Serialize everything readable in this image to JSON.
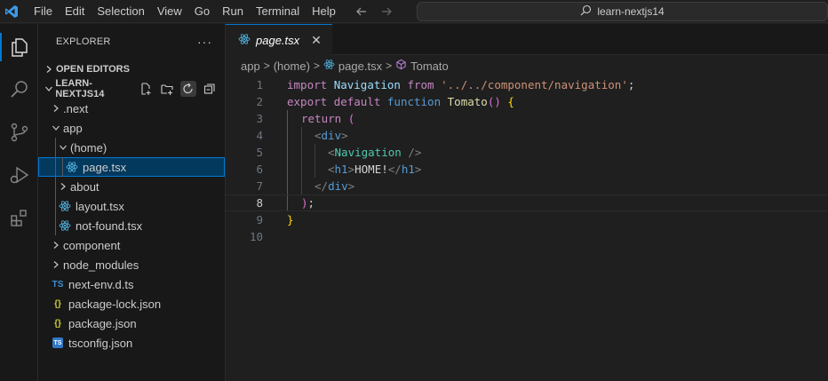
{
  "menu": [
    "File",
    "Edit",
    "Selection",
    "View",
    "Go",
    "Run",
    "Terminal",
    "Help"
  ],
  "search": {
    "text": "learn-nextjs14"
  },
  "sidebar": {
    "title": "EXPLORER",
    "more": "···",
    "open_editors": "OPEN EDITORS",
    "project": "LEARN-NEXTJS14",
    "items": [
      {
        "label": ".next",
        "type": "folder",
        "expanded": false
      },
      {
        "label": "app",
        "type": "folder",
        "expanded": true
      },
      {
        "label": "(home)",
        "type": "folder",
        "expanded": true
      },
      {
        "label": "page.tsx",
        "type": "react",
        "selected": true
      },
      {
        "label": "about",
        "type": "folder",
        "expanded": false
      },
      {
        "label": "layout.tsx",
        "type": "react"
      },
      {
        "label": "not-found.tsx",
        "type": "react"
      },
      {
        "label": "component",
        "type": "folder",
        "expanded": false
      },
      {
        "label": "node_modules",
        "type": "folder",
        "expanded": false
      },
      {
        "label": "next-env.d.ts",
        "type": "ts",
        "icon_text": "TS"
      },
      {
        "label": "package-lock.json",
        "type": "json",
        "icon_text": "{}"
      },
      {
        "label": "package.json",
        "type": "json",
        "icon_text": "{}"
      },
      {
        "label": "tsconfig.json",
        "type": "tsconfig",
        "icon_text": "TS"
      }
    ]
  },
  "tab": {
    "label": "page.tsx",
    "close": "✕"
  },
  "breadcrumbs": {
    "items": [
      "app",
      "(home)",
      "page.tsx",
      "Tomato"
    ],
    "sep": ">"
  },
  "editor": {
    "current_line": 8,
    "lines": [
      {
        "n": "1"
      },
      {
        "n": "2"
      },
      {
        "n": "3"
      },
      {
        "n": "4"
      },
      {
        "n": "5"
      },
      {
        "n": "6"
      },
      {
        "n": "7"
      },
      {
        "n": "8"
      },
      {
        "n": "9"
      },
      {
        "n": "10"
      }
    ],
    "code": {
      "l1": {
        "t1": "import",
        "t2": "Navigation",
        "t3": "from",
        "t4": "'../../component/navigation'",
        "t5": ";"
      },
      "l2": {
        "t1": "export",
        "t2": "default",
        "t3": "function",
        "t4": "Tomato",
        "t5": "()",
        "t6": "{"
      },
      "l3": {
        "t1": "return",
        "t2": "("
      },
      "l4": {
        "t1": "<",
        "t2": "div",
        "t3": ">"
      },
      "l5": {
        "t1": "<",
        "t2": "Navigation",
        "t3": "/>"
      },
      "l6": {
        "t1": "<",
        "t2": "h1",
        "t3": ">",
        "t4": "HOME!",
        "t5": "</",
        "t6": "h1",
        "t7": ">"
      },
      "l7": {
        "t1": "</",
        "t2": "div",
        "t3": ">"
      },
      "l8": {
        "t1": ")",
        "t2": ";"
      },
      "l9": {
        "t1": "}"
      },
      "l10": {}
    }
  },
  "colors": {
    "accent": "#0078d4",
    "selection": "#04395e"
  }
}
